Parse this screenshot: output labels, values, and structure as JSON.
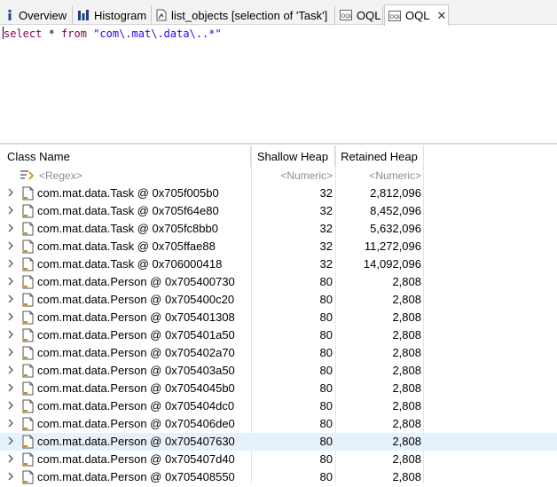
{
  "tabs": [
    {
      "label": "Overview",
      "icon": "info-icon"
    },
    {
      "label": "Histogram",
      "icon": "histogram-icon"
    },
    {
      "label": "list_objects [selection of 'Task']",
      "icon": "file-icon"
    },
    {
      "label": "OQL",
      "icon": "oql-icon"
    },
    {
      "label": "OQL",
      "icon": "oql-icon",
      "active": true,
      "close": "✕"
    }
  ],
  "editor": {
    "kw_select": "select",
    "star": " * ",
    "kw_from": "from",
    "space": " ",
    "pattern": "\"com\\.mat\\.data\\..*\""
  },
  "table": {
    "columns": [
      "Class Name",
      "Shallow Heap",
      "Retained Heap"
    ],
    "filters": [
      "<Regex>",
      "<Numeric>",
      "<Numeric>"
    ],
    "rows": [
      {
        "name": "com.mat.data.Task @ 0x705f005b0",
        "shallow": "32",
        "retained": "2,812,096"
      },
      {
        "name": "com.mat.data.Task @ 0x705f64e80",
        "shallow": "32",
        "retained": "8,452,096"
      },
      {
        "name": "com.mat.data.Task @ 0x705fc8bb0",
        "shallow": "32",
        "retained": "5,632,096"
      },
      {
        "name": "com.mat.data.Task @ 0x705ffae88",
        "shallow": "32",
        "retained": "11,272,096"
      },
      {
        "name": "com.mat.data.Task @ 0x706000418",
        "shallow": "32",
        "retained": "14,092,096"
      },
      {
        "name": "com.mat.data.Person @ 0x705400730",
        "shallow": "80",
        "retained": "2,808"
      },
      {
        "name": "com.mat.data.Person @ 0x705400c20",
        "shallow": "80",
        "retained": "2,808"
      },
      {
        "name": "com.mat.data.Person @ 0x705401308",
        "shallow": "80",
        "retained": "2,808"
      },
      {
        "name": "com.mat.data.Person @ 0x705401a50",
        "shallow": "80",
        "retained": "2,808"
      },
      {
        "name": "com.mat.data.Person @ 0x705402a70",
        "shallow": "80",
        "retained": "2,808"
      },
      {
        "name": "com.mat.data.Person @ 0x705403a50",
        "shallow": "80",
        "retained": "2,808"
      },
      {
        "name": "com.mat.data.Person @ 0x7054045b0",
        "shallow": "80",
        "retained": "2,808"
      },
      {
        "name": "com.mat.data.Person @ 0x705404dc0",
        "shallow": "80",
        "retained": "2,808"
      },
      {
        "name": "com.mat.data.Person @ 0x705406de0",
        "shallow": "80",
        "retained": "2,808"
      },
      {
        "name": "com.mat.data.Person @ 0x705407630",
        "shallow": "80",
        "retained": "2,808",
        "selected": true
      },
      {
        "name": "com.mat.data.Person @ 0x705407d40",
        "shallow": "80",
        "retained": "2,808"
      },
      {
        "name": "com.mat.data.Person @ 0x705408550",
        "shallow": "80",
        "retained": "2,808"
      }
    ]
  },
  "colors": {
    "keyword": "#7f0055",
    "string": "#2a00ff",
    "selection": "#e5f1fb"
  }
}
